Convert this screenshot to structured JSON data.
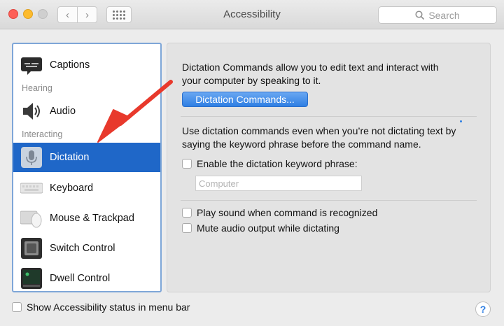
{
  "window": {
    "title": "Accessibility",
    "search_placeholder": "Search",
    "nav_back_glyph": "‹",
    "nav_forward_glyph": "›"
  },
  "sidebar": {
    "items": [
      {
        "label": "Captions",
        "icon": "captions-icon"
      },
      {
        "label": "Audio",
        "icon": "speaker-icon"
      },
      {
        "label": "Dictation",
        "icon": "microphone-icon",
        "selected": true
      },
      {
        "label": "Keyboard",
        "icon": "keyboard-icon"
      },
      {
        "label": "Mouse & Trackpad",
        "icon": "mouse-icon"
      },
      {
        "label": "Switch Control",
        "icon": "switch-control-icon"
      },
      {
        "label": "Dwell Control",
        "icon": "dwell-control-icon"
      }
    ],
    "headers": {
      "hearing": "Hearing",
      "interacting": "Interacting"
    }
  },
  "panel": {
    "intro_line1": "Dictation Commands allow you to edit text and interact with",
    "intro_line2": "your computer by speaking to it.",
    "commands_button": "Dictation Commands...",
    "desc_line1": "Use dictation commands even when you’re not dictating text by",
    "desc_line2": "saying the keyword phrase before the command name.",
    "enable_keyword_label": "Enable the dictation keyword phrase:",
    "keyword_placeholder": "Computer",
    "play_sound_label": "Play sound when command is recognized",
    "mute_audio_label": "Mute audio output while dictating"
  },
  "bottom": {
    "status_label": "Show Accessibility status in menu bar",
    "help_glyph": "?"
  },
  "colors": {
    "accent": "#1f67c8",
    "arrow": "#e8392c",
    "button": "#2f7fe3"
  }
}
